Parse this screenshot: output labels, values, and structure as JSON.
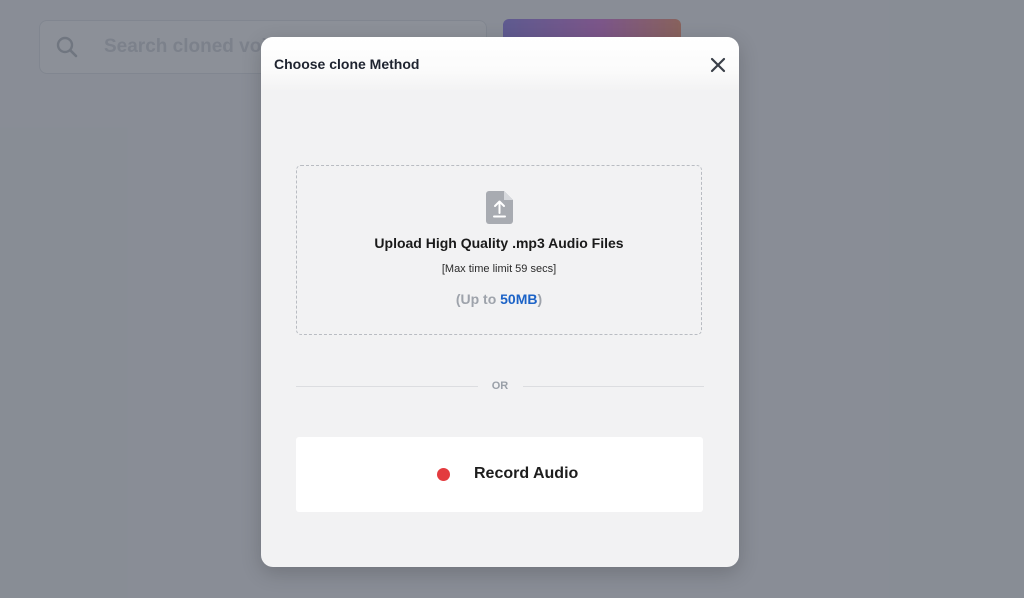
{
  "background": {
    "search": {
      "placeholder": "Search cloned voices",
      "icon": "search-icon"
    },
    "action_button": {
      "accent_start": "#5b3fe0",
      "accent_end": "#f05a2a"
    }
  },
  "modal": {
    "title": "Choose clone Method",
    "close_icon": "close-icon",
    "upload": {
      "icon": "file-upload-icon",
      "title": "Upload High Quality .mp3 Audio Files",
      "time_limit": "[Max time limit 59 secs]",
      "size_prefix": "(Up to ",
      "size_value": "50MB",
      "size_suffix": ")",
      "size_color": "#1c63c7"
    },
    "divider_text": "OR",
    "record": {
      "icon": "record-dot-icon",
      "label": "Record Audio",
      "dot_color": "#e33b3f"
    }
  }
}
